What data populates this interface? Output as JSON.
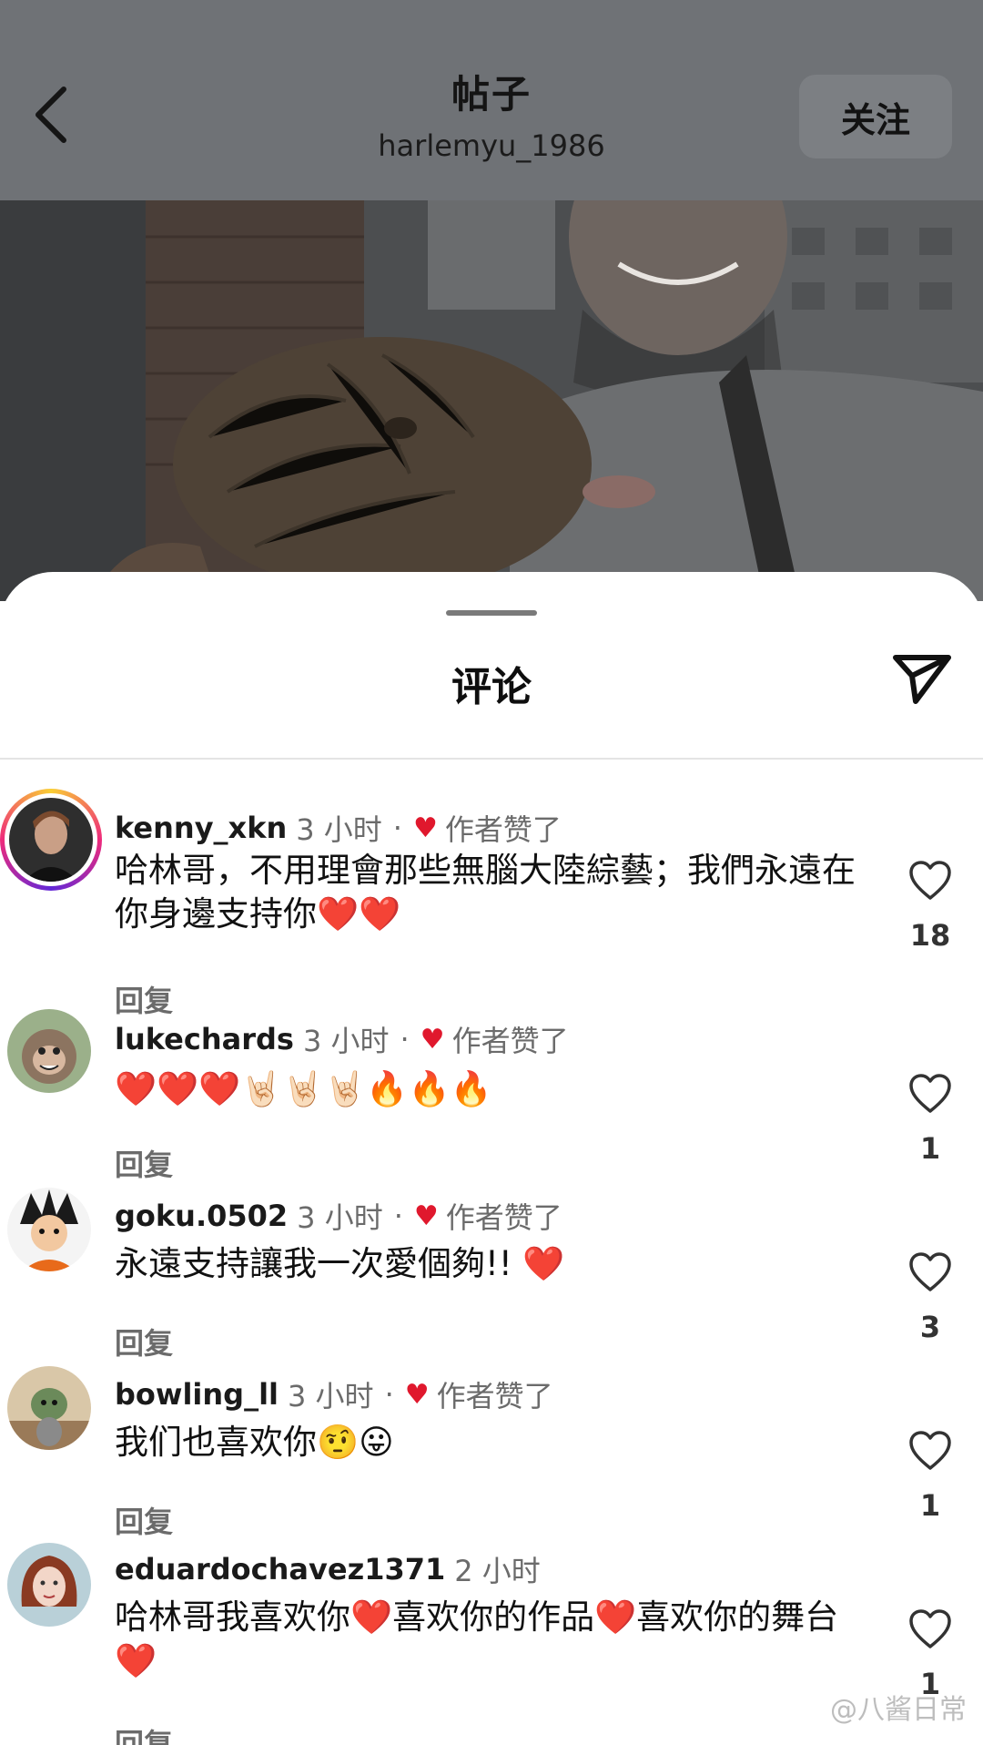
{
  "header": {
    "title": "帖子",
    "username": "harlemyu_1986",
    "follow_label": "关注"
  },
  "sheet": {
    "title": "评论"
  },
  "comments": [
    {
      "username": "kenny_xkn",
      "time": "3 小时",
      "separator": "·",
      "author_liked": "作者赞了",
      "text": "哈林哥，不用理會那些無腦大陸綜藝；我們永遠在你身邊支持你❤️❤️",
      "reply": "回复",
      "likes": "18"
    },
    {
      "username": "lukechards",
      "time": "3 小时",
      "separator": "·",
      "author_liked": "作者赞了",
      "text": "❤️❤️❤️🤘🏻🤘🏻🤘🏻🔥🔥🔥",
      "reply": "回复",
      "likes": "1"
    },
    {
      "username": "goku.0502",
      "time": "3 小时",
      "separator": "·",
      "author_liked": "作者赞了",
      "text": "永遠支持讓我一次愛個夠!! ❤️",
      "reply": "回复",
      "likes": "3"
    },
    {
      "username": "bowling_ll",
      "time": "3 小时",
      "separator": "·",
      "author_liked": "作者赞了",
      "text": "我们也喜欢你🤨😛",
      "reply": "回复",
      "likes": "1"
    },
    {
      "username": "eduardochavez1371",
      "time": "2 小时",
      "text": "哈林哥我喜欢你❤️喜欢你的作品❤️喜欢你的舞台❤️",
      "reply": "回复",
      "likes": "1"
    }
  ],
  "watermark": "@八酱日常",
  "colors": {
    "liked_heart": "#e0182d",
    "story_ring": "#ee2a7b"
  }
}
